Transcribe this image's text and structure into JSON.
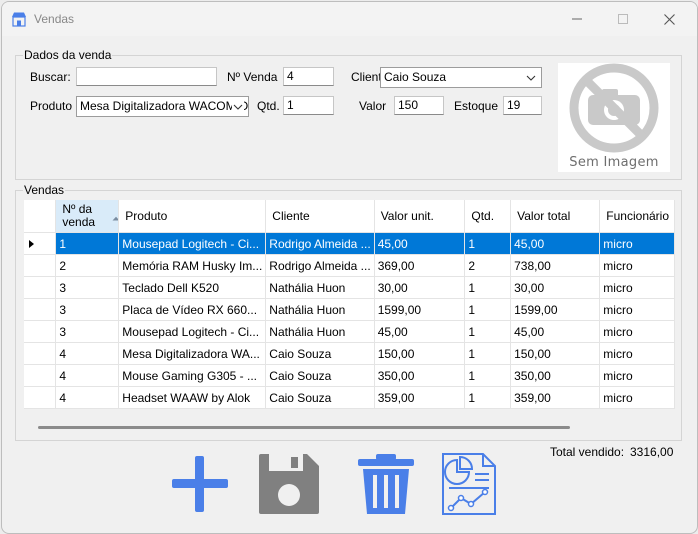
{
  "window": {
    "title": "Vendas"
  },
  "dados": {
    "legend": "Dados da venda",
    "buscar_label": "Buscar:",
    "buscar_value": "",
    "nvenda_label": "Nº Venda",
    "nvenda_value": "4",
    "cliente_label": "Cliente",
    "cliente_value": "Caio Souza",
    "produto_label": "Produto",
    "produto_value": "Mesa Digitalizadora WACOM OI",
    "qtd_label": "Qtd.",
    "qtd_value": "1",
    "valor_label": "Valor",
    "valor_value": "150",
    "estoque_label": "Estoque",
    "estoque_value": "19",
    "image_text": "Sem Imagem"
  },
  "vendas": {
    "legend": "Vendas",
    "columns": [
      "Nº da venda",
      "Produto",
      "Cliente",
      "Valor unit.",
      "Qtd.",
      "Valor total",
      "Funcionário"
    ],
    "rows": [
      [
        "1",
        "Mousepad Logitech - Ci...",
        "Rodrigo Almeida ...",
        "45,00",
        "1",
        "45,00",
        "micro"
      ],
      [
        "2",
        "Memória RAM Husky Im...",
        "Rodrigo Almeida ...",
        "369,00",
        "2",
        "738,00",
        "micro"
      ],
      [
        "3",
        "Teclado Dell K520",
        "Nathália Huon",
        "30,00",
        "1",
        "30,00",
        "micro"
      ],
      [
        "3",
        "Placa de Vídeo RX 660...",
        "Nathália Huon",
        "1599,00",
        "1",
        "1599,00",
        "micro"
      ],
      [
        "3",
        "Mousepad Logitech - Ci...",
        "Nathália Huon",
        "45,00",
        "1",
        "45,00",
        "micro"
      ],
      [
        "4",
        "Mesa Digitalizadora WA...",
        "Caio Souza",
        "150,00",
        "1",
        "150,00",
        "micro"
      ],
      [
        "4",
        "Mouse Gaming G305 - ...",
        "Caio Souza",
        "350,00",
        "1",
        "350,00",
        "micro"
      ],
      [
        "4",
        "Headset WAAW by Alok",
        "Caio Souza",
        "359,00",
        "1",
        "359,00",
        "micro"
      ]
    ],
    "selected_row": 0
  },
  "total": {
    "label": "Total vendido:",
    "value": "3316,00"
  },
  "buttons": {
    "add": "plus-icon",
    "save": "floppy-disk-icon",
    "delete": "trash-icon",
    "report": "report-chart-icon"
  },
  "colors": {
    "accent": "#0078d7",
    "icon_blue": "#4a7fe8",
    "icon_gray": "#808080"
  }
}
